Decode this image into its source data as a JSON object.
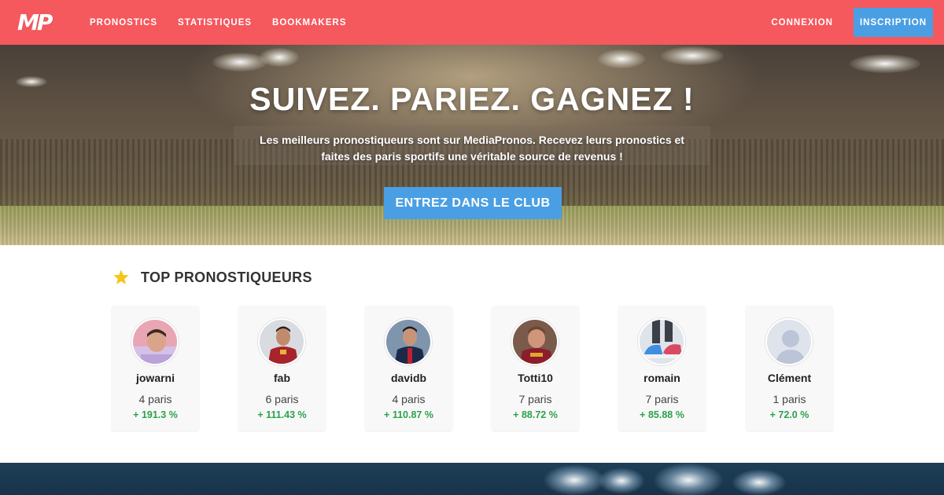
{
  "navbar": {
    "logo": "MP",
    "links": [
      "PRONOSTICS",
      "STATISTIQUES",
      "BOOKMAKERS"
    ],
    "login": "CONNEXION",
    "signup": "INSCRIPTION"
  },
  "hero": {
    "title": "SUIVEZ. PARIEZ. GAGNEZ !",
    "subtitle_line1": "Les meilleurs pronostiqueurs sont sur MediaPronos. Recevez leurs pronostics et",
    "subtitle_line2": "faites des paris sportifs une véritable source de revenus !",
    "cta": "ENTREZ DANS LE CLUB"
  },
  "top": {
    "icon": "star-icon",
    "title": "TOP PRONOSTIQUEURS",
    "tipsters": [
      {
        "name": "jowarni",
        "bets": "4 paris",
        "gain": "+ 191.3 %"
      },
      {
        "name": "fab",
        "bets": "6 paris",
        "gain": "+ 111.43 %"
      },
      {
        "name": "davidb",
        "bets": "4 paris",
        "gain": "+ 110.87 %"
      },
      {
        "name": "Totti10",
        "bets": "7 paris",
        "gain": "+ 88.72 %"
      },
      {
        "name": "romain",
        "bets": "7 paris",
        "gain": "+ 85.88 %"
      },
      {
        "name": "Clément",
        "bets": "1 paris",
        "gain": "+ 72.0 %"
      }
    ]
  },
  "colors": {
    "navbar": "#f5585d",
    "accent_blue": "#4a9fe4",
    "gain_green": "#2ba24c",
    "star": "#f5c518"
  }
}
